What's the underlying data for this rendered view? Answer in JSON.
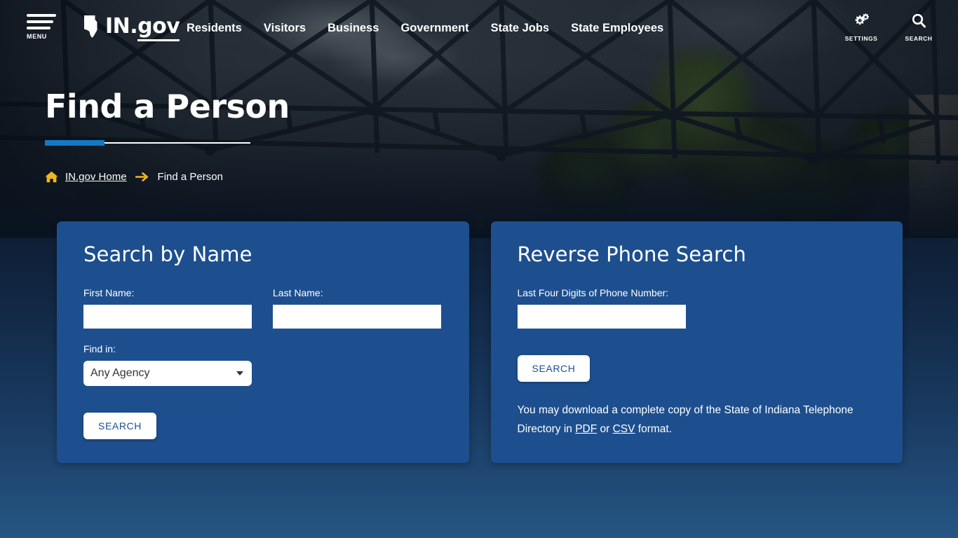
{
  "header": {
    "menu_label": "MENU",
    "brand_in": "IN.",
    "brand_gov": "gov",
    "nav": [
      {
        "label": "Residents"
      },
      {
        "label": "Visitors"
      },
      {
        "label": "Business"
      },
      {
        "label": "Government"
      },
      {
        "label": "State Jobs"
      },
      {
        "label": "State Employees"
      }
    ],
    "tools": [
      {
        "label": "SETTINGS",
        "icon": "gears-icon"
      },
      {
        "label": "SEARCH",
        "icon": "magnifier-icon"
      }
    ]
  },
  "hero": {
    "title": "Find a Person"
  },
  "breadcrumb": {
    "home_icon": "home-icon",
    "home_label": "IN.gov Home",
    "arrow_icon": "arrow-right-icon",
    "current": "Find a Person"
  },
  "cards": {
    "search_by_name": {
      "title": "Search by Name",
      "first_name_label": "First Name:",
      "first_name_value": "",
      "first_name_placeholder": "",
      "last_name_label": "Last Name:",
      "last_name_value": "",
      "last_name_placeholder": "",
      "find_in_label": "Find in:",
      "find_in_selected": "Any Agency",
      "search_button": "SEARCH"
    },
    "reverse_phone": {
      "title": "Reverse Phone Search",
      "phone_label": "Last Four Digits of Phone Number:",
      "phone_value": "",
      "phone_placeholder": "",
      "search_button": "SEARCH",
      "note_part1": "You may download a complete copy of the State of Indiana Telephone Directory in ",
      "note_pdf": "PDF",
      "note_or": " or ",
      "note_csv": "CSV",
      "note_part2": " format."
    }
  },
  "colors": {
    "card_blue": "#1d4f8f",
    "accent_blue": "#1479c4",
    "breadcrumb_gold": "#f3b51f",
    "white": "#ffffff"
  }
}
